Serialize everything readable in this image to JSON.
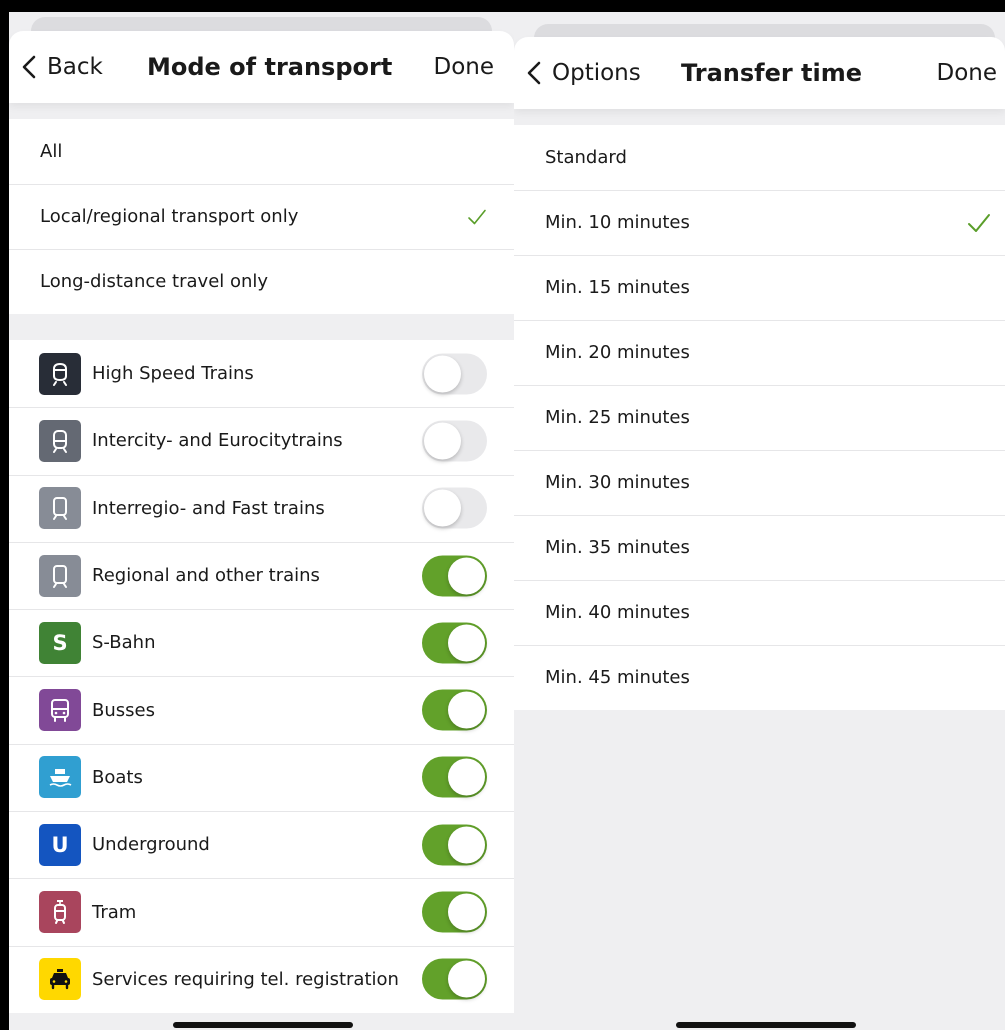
{
  "left": {
    "nav": {
      "back_label": "Back",
      "title": "Mode of transport",
      "done_label": "Done"
    },
    "scope_options": [
      {
        "label": "All",
        "selected": false
      },
      {
        "label": "Local/regional transport only",
        "selected": true
      },
      {
        "label": "Long-distance travel only",
        "selected": false
      }
    ],
    "transport_modes": [
      {
        "label": "High Speed Trains",
        "icon": "high-speed-train-icon",
        "icon_color": "#282d37",
        "enabled": false
      },
      {
        "label": "Intercity- and Eurocitytrains",
        "icon": "intercity-train-icon",
        "icon_color": "#646973",
        "enabled": false
      },
      {
        "label": "Interregio- and Fast trains",
        "icon": "interregio-train-icon",
        "icon_color": "#878c96",
        "enabled": false
      },
      {
        "label": "Regional and other trains",
        "icon": "regional-train-icon",
        "icon_color": "#878c96",
        "enabled": true
      },
      {
        "label": "S-Bahn",
        "icon": "s-bahn-icon",
        "icon_text": "S",
        "icon_color": "#408335",
        "enabled": true
      },
      {
        "label": "Busses",
        "icon": "bus-icon",
        "icon_color": "#814997",
        "enabled": true
      },
      {
        "label": "Boats",
        "icon": "boat-icon",
        "icon_color": "#309fd1",
        "enabled": true
      },
      {
        "label": "Underground",
        "icon": "underground-icon",
        "icon_text": "U",
        "icon_color": "#1455c0",
        "enabled": true
      },
      {
        "label": "Tram",
        "icon": "tram-icon",
        "icon_color": "#a9455d",
        "enabled": true
      },
      {
        "label": "Services requiring tel. registration",
        "icon": "taxi-icon",
        "icon_color": "#ffd800",
        "enabled": true
      }
    ]
  },
  "right": {
    "nav": {
      "back_label": "Options",
      "title": "Transfer time",
      "done_label": "Done"
    },
    "options": [
      {
        "label": "Standard",
        "selected": false
      },
      {
        "label": "Min. 10 minutes",
        "selected": true
      },
      {
        "label": "Min. 15 minutes",
        "selected": false
      },
      {
        "label": "Min. 20 minutes",
        "selected": false
      },
      {
        "label": "Min. 25 minutes",
        "selected": false
      },
      {
        "label": "Min. 30 minutes",
        "selected": false
      },
      {
        "label": "Min. 35 minutes",
        "selected": false
      },
      {
        "label": "Min. 40 minutes",
        "selected": false
      },
      {
        "label": "Min. 45 minutes",
        "selected": false
      }
    ]
  },
  "colors": {
    "accent_green": "#62a12a",
    "check_green": "#5a9e2a"
  }
}
